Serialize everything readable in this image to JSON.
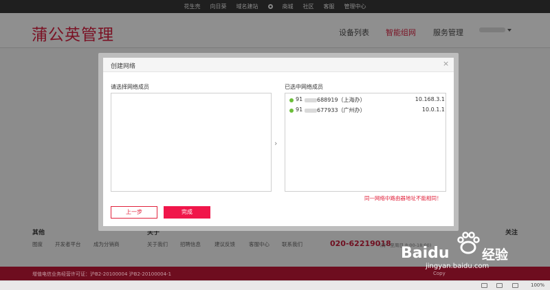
{
  "topnav": {
    "items": [
      "花生壳",
      "向日葵",
      "域名建站",
      "商城",
      "社区",
      "客服",
      "管理中心"
    ]
  },
  "header": {
    "logo": "蒲公英管理",
    "nav": [
      {
        "label": "设备列表"
      },
      {
        "label": "智能组网"
      },
      {
        "label": "服务管理"
      }
    ]
  },
  "modal": {
    "title": "创建网络",
    "close": "×",
    "left_label": "请选择网络成员",
    "right_label": "已选中网络成员",
    "arrow": "›",
    "members": [
      {
        "prefix": "91",
        "suffix": "688919（上海办）",
        "ip": "10.168.3.1"
      },
      {
        "prefix": "91",
        "suffix": "677933（广州办）",
        "ip": "10.0.1.1"
      }
    ],
    "warning": "同一网络中路由器地址不能相同！",
    "prev_label": "上一步",
    "done_label": "完成"
  },
  "footer": {
    "col_other": "其他",
    "col_about": "关于",
    "col_follow": "关注",
    "links_other": [
      "图度",
      "开发者平台",
      "成为分销商"
    ],
    "links_about": [
      "关于我们",
      "招聘信息",
      "建议反馈",
      "客服中心",
      "联系我们"
    ],
    "phone": "020-62219018",
    "hours": "(周一至周日 8:00-18:00)"
  },
  "bottombar": {
    "license": "增值电信业务经营许可证：沪B2-20100004 沪B2-20100004-1",
    "copyright": "Copy"
  },
  "statusbar": {
    "zoom": "100%"
  },
  "watermark": {
    "brand": "Baidu",
    "cn": "经验",
    "url": "jingyan.baidu.com"
  },
  "colors": {
    "brand_red": "#e0203a",
    "done_button": "#f0164a",
    "online_dot": "#6cbe3a"
  }
}
